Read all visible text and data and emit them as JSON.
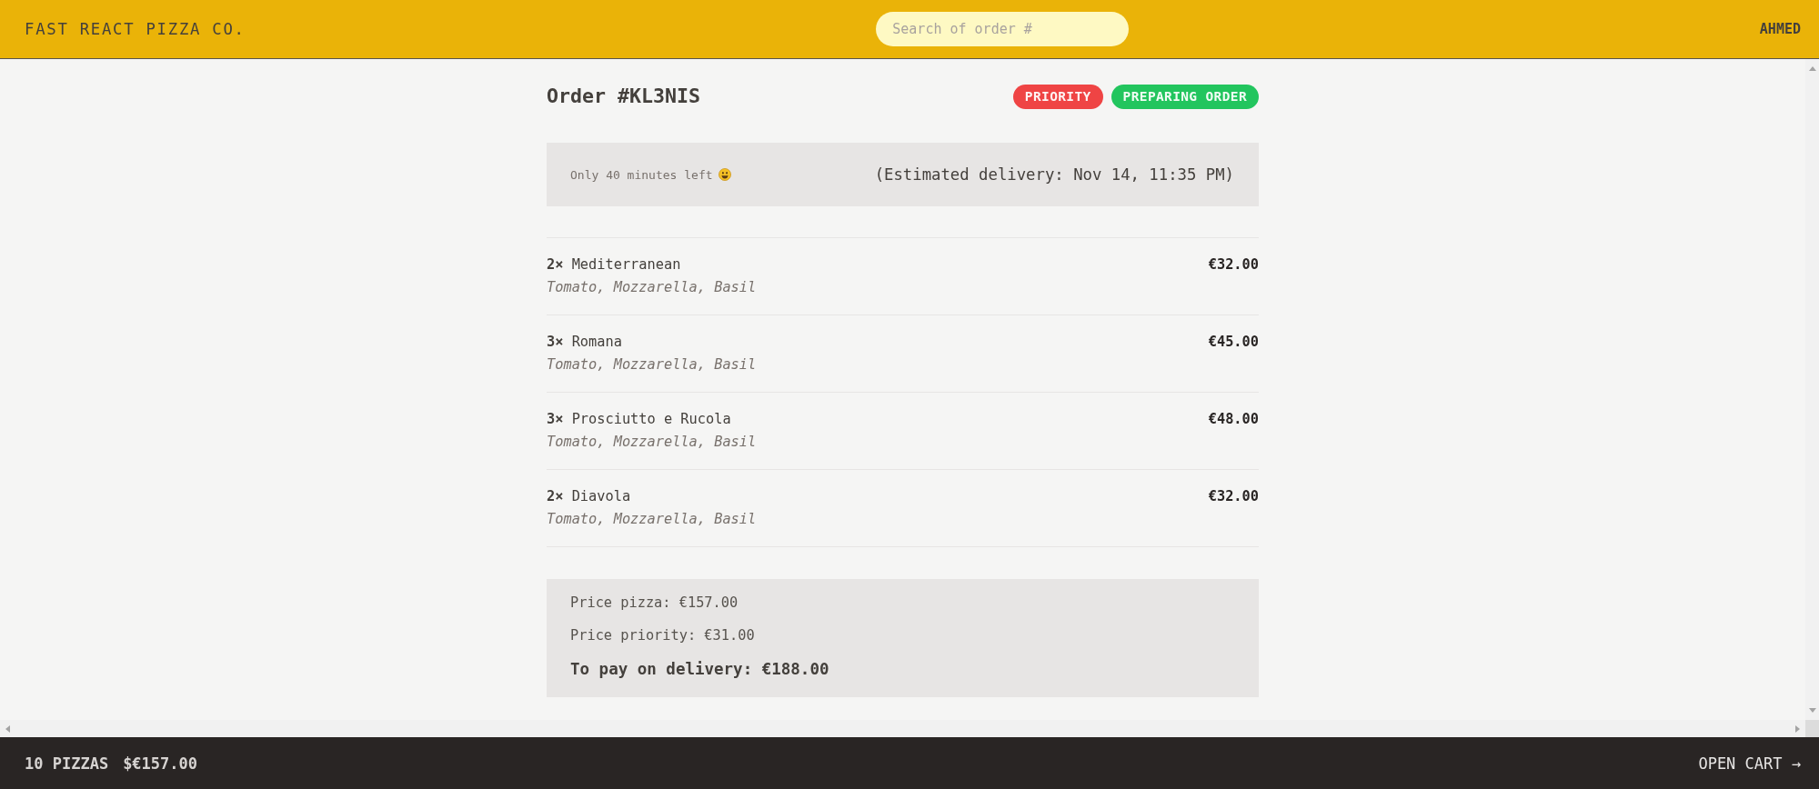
{
  "header": {
    "logo": "FAST REACT PIZZA CO.",
    "search": {
      "placeholder": "Search of order #"
    },
    "username": "AHMED"
  },
  "order": {
    "title": "Order #KL3NIS",
    "badges": [
      {
        "label": "PRIORITY",
        "color": "#ef4444"
      },
      {
        "label": "PREPARING ORDER",
        "color": "#22c55e"
      }
    ],
    "delivery": {
      "time_left": "Only 40 minutes left",
      "estimate": "(Estimated delivery: Nov 14, 11:35 PM)"
    },
    "items": [
      {
        "name": "**2×** Mediterranean",
        "price": "€32.00",
        "ingredients": "Tomato, Mozzarella, Basil"
      },
      {
        "name": "**3×** Romana",
        "price": "€45.00",
        "ingredients": "Tomato, Mozzarella, Basil"
      },
      {
        "name": "**3×** Prosciutto e Rucola",
        "price": "€48.00",
        "ingredients": "Tomato, Mozzarella, Basil"
      },
      {
        "name": "**2×** Diavola",
        "price": "€32.00",
        "ingredients": "Tomato, Mozzarella, Basil"
      }
    ],
    "summary": {
      "lines": [
        "Price pizza: €157.00",
        "Price priority: €31.00"
      ],
      "total": "To pay on delivery: €188.00"
    }
  },
  "cart_bar": {
    "count": "10 PIZZAS",
    "total": "$€157.00",
    "link": "OPEN CART →"
  }
}
